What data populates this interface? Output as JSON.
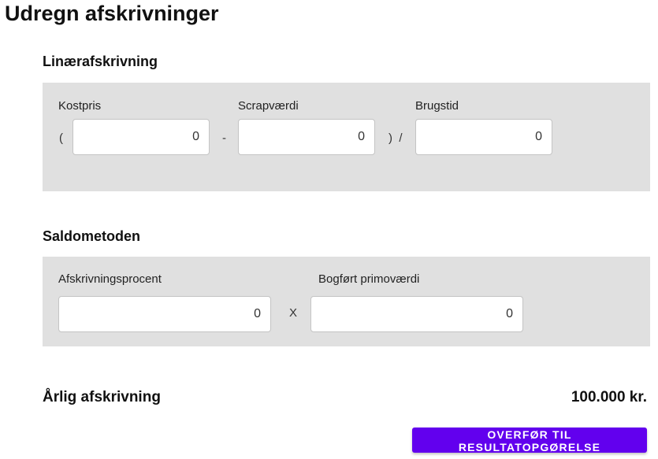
{
  "page": {
    "title": "Udregn afskrivninger"
  },
  "linear": {
    "title": "Linærafskrivning",
    "open_paren": "(",
    "minus": "-",
    "close_paren_divide": ")  /",
    "cost": {
      "label": "Kostpris",
      "value": "0"
    },
    "scrap": {
      "label": "Scrapværdi",
      "value": "0"
    },
    "lifetime": {
      "label": "Brugstid",
      "value": "0"
    }
  },
  "balance": {
    "title": "Saldometoden",
    "multiply": "X",
    "percent": {
      "label": "Afskrivningsprocent",
      "value": "0"
    },
    "book_value": {
      "label": "Bogført primoværdi",
      "value": "0"
    }
  },
  "result": {
    "label": "Årlig afskrivning",
    "value": "100.000 kr."
  },
  "actions": {
    "transfer_label": "OVERFØR TIL RESULTATOPGØRELSE"
  },
  "colors": {
    "accent": "#6200ee",
    "panel_background": "#e0e0e0"
  }
}
